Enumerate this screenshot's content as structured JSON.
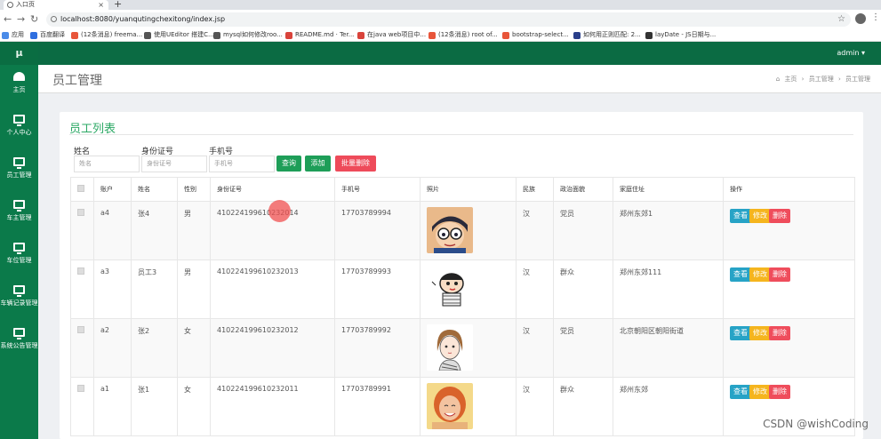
{
  "browser": {
    "tab_title": "入口页",
    "url": "localhost:8080/yuanqutingchexitong/index.jsp",
    "bookmarks": [
      {
        "label": "应用",
        "color": "#4a8be8"
      },
      {
        "label": "百度翻译",
        "color": "#2f6fe0"
      },
      {
        "label": "(12条消息) freema...",
        "color": "#e8553a"
      },
      {
        "label": "使用UEditor 搭建C...",
        "color": "#555555"
      },
      {
        "label": "mysql如何修改roo...",
        "color": "#555555"
      },
      {
        "label": "README.md · Ter...",
        "color": "#d9433b"
      },
      {
        "label": "在java web项目中...",
        "color": "#d9433b"
      },
      {
        "label": "(12条消息) root of...",
        "color": "#e8553a"
      },
      {
        "label": "bootstrap-select...",
        "color": "#e8553a"
      },
      {
        "label": "如何用正则匹配: 2...",
        "color": "#2a3f8a"
      },
      {
        "label": "layDate - JS日期与...",
        "color": "#333333"
      }
    ]
  },
  "sidebar": {
    "logo": "μ",
    "items": [
      {
        "label": "主页",
        "icon": "dashboard-icon"
      },
      {
        "label": "个人中心",
        "icon": "monitor-icon"
      },
      {
        "label": "员工管理",
        "icon": "monitor-icon"
      },
      {
        "label": "车主管理",
        "icon": "monitor-icon"
      },
      {
        "label": "车位管理",
        "icon": "monitor-icon"
      },
      {
        "label": "车辆记录管理",
        "icon": "monitor-icon"
      },
      {
        "label": "系统公告管理",
        "icon": "monitor-icon"
      }
    ]
  },
  "topbar": {
    "user": "admin ▾"
  },
  "header": {
    "title": "员工管理",
    "breadcrumb": [
      "主页",
      "员工管理",
      "员工管理"
    ]
  },
  "panel": {
    "title": "员工列表",
    "filters": [
      {
        "label": "姓名",
        "placeholder": "姓名"
      },
      {
        "label": "身份证号",
        "placeholder": "身份证号"
      },
      {
        "label": "手机号",
        "placeholder": "手机号"
      }
    ],
    "buttons": {
      "search": "查询",
      "add": "添加",
      "batch_delete": "批量删除"
    }
  },
  "table": {
    "headers": [
      "账户",
      "姓名",
      "性别",
      "身份证号",
      "手机号",
      "照片",
      "民族",
      "政治面貌",
      "家庭住址",
      "操作"
    ],
    "rows": [
      {
        "account": "a4",
        "name": "张4",
        "gender": "男",
        "id_card": "410224199610232014",
        "phone": "17703789994",
        "photo": "cartoon-boy-glasses",
        "ethnicity": "汉",
        "political": "党员",
        "address": "郑州东郊1"
      },
      {
        "account": "a3",
        "name": "员工3",
        "gender": "男",
        "id_card": "410224199610232013",
        "phone": "17703789993",
        "photo": "crayon-shin-chan",
        "ethnicity": "汉",
        "political": "群众",
        "address": "郑州东郊111"
      },
      {
        "account": "a2",
        "name": "张2",
        "gender": "女",
        "id_card": "410224199610232012",
        "phone": "17703789992",
        "photo": "sketch-girl",
        "ethnicity": "汉",
        "political": "党员",
        "address": "北京朝阳区朝阳街道"
      },
      {
        "account": "a1",
        "name": "张1",
        "gender": "女",
        "id_card": "410224199610232011",
        "phone": "17703789991",
        "photo": "smiling-girl",
        "ethnicity": "汉",
        "political": "群众",
        "address": "郑州东郊"
      }
    ],
    "actions": {
      "view": "查看",
      "edit": "修改",
      "delete": "删除"
    }
  },
  "watermark": "CSDN @wishCoding"
}
